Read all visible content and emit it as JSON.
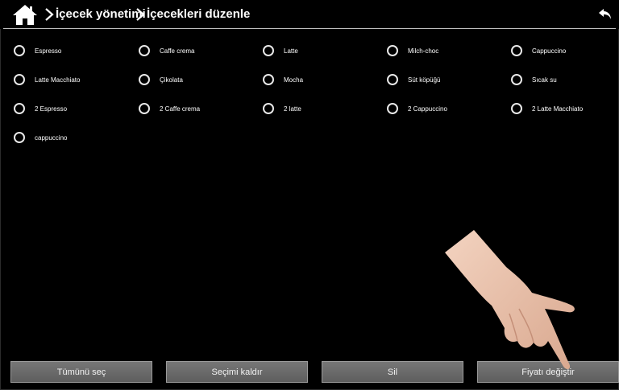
{
  "header": {
    "breadcrumb": [
      "İçecek yönetimi",
      "İçecekleri düzenle"
    ]
  },
  "drinks": [
    [
      "Espresso",
      "Caffe crema",
      "Latte",
      "Milch-choc",
      "Cappuccino"
    ],
    [
      "Latte Macchiato",
      "Çikolata",
      "Mocha",
      "Süt köpüğü",
      "Sıcak su"
    ],
    [
      "2 Espresso",
      "2 Caffe crema",
      "2 latte",
      "2 Cappuccino",
      "2 Latte Macchiato"
    ],
    [
      "cappuccino"
    ]
  ],
  "buttons": {
    "select_all": "Tümünü seç",
    "deselect": "Seçimi kaldır",
    "delete": "Sil",
    "change_price": "Fiyatı değiştir"
  }
}
